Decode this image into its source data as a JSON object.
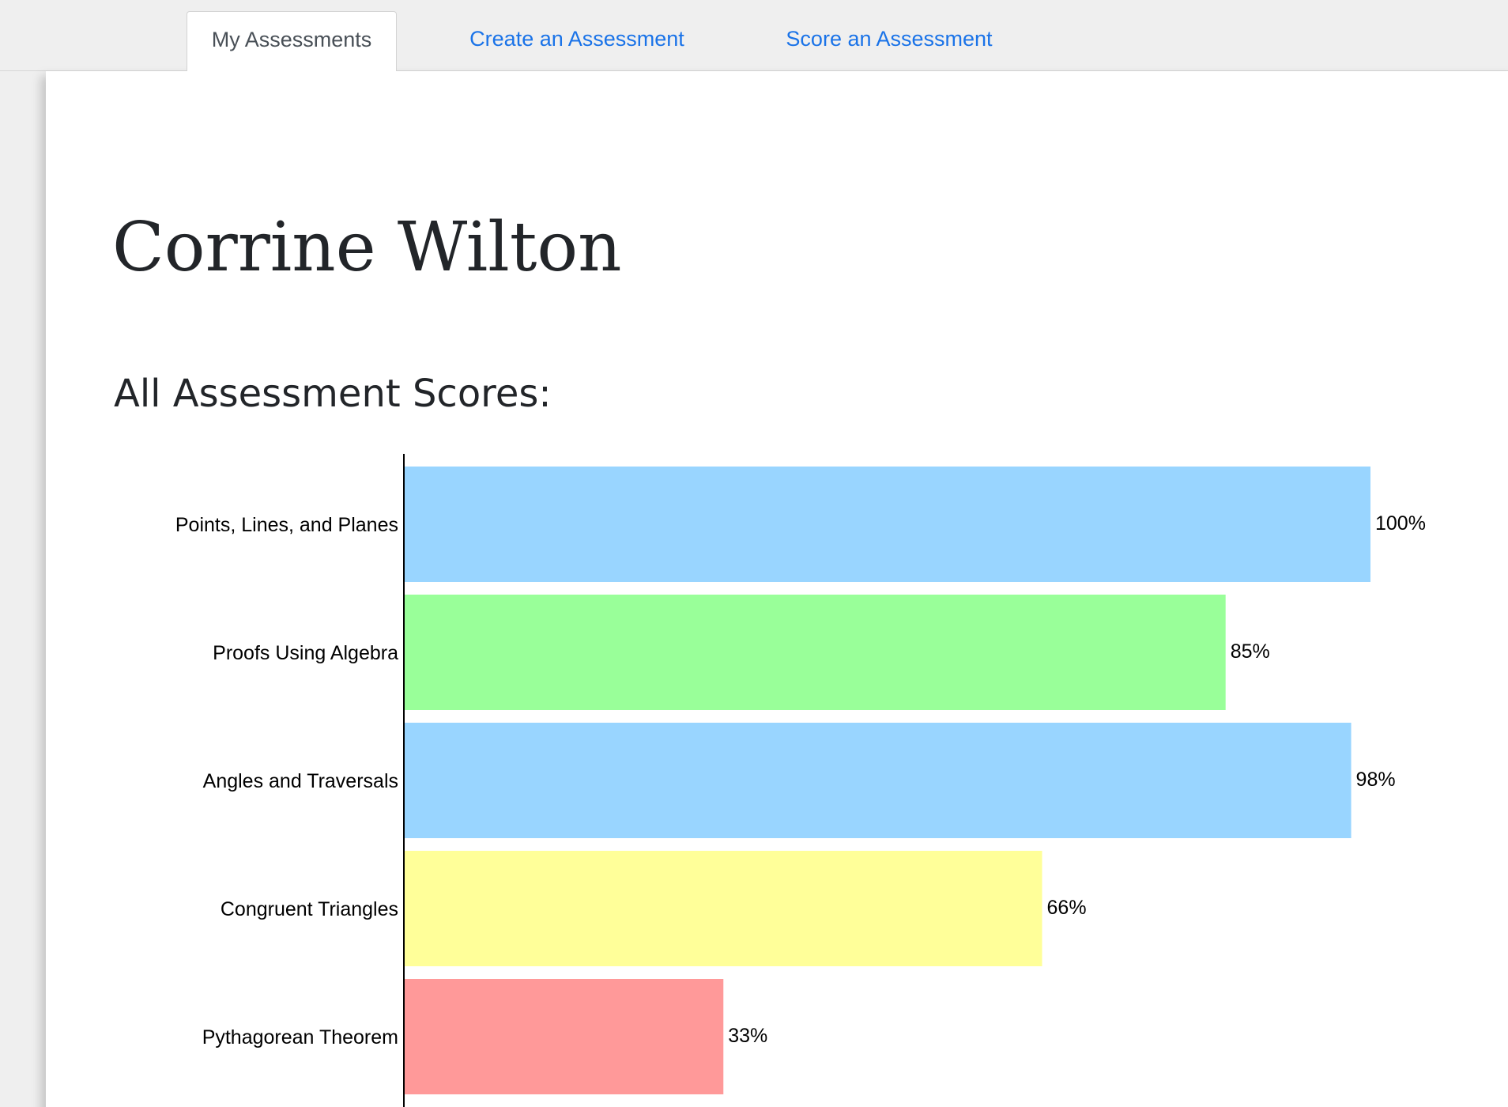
{
  "tabs": [
    {
      "label": "My Assessments",
      "active": true
    },
    {
      "label": "Create an Assessment",
      "active": false
    },
    {
      "label": "Score an Assessment",
      "active": false
    }
  ],
  "student": {
    "name": "Corrine Wilton"
  },
  "section_title": "All Assessment Scores:",
  "colors": {
    "link": "#1a73e8",
    "tab_active_text": "#495057",
    "heading": "#222529",
    "background": "#efefef",
    "card": "#ffffff"
  },
  "chart_data": {
    "type": "bar",
    "orientation": "horizontal",
    "categories": [
      "Points, Lines, and Planes",
      "Proofs Using Algebra",
      "Angles and Traversals",
      "Congruent Triangles",
      "Pythagorean Theorem"
    ],
    "values": [
      100,
      85,
      98,
      66,
      33
    ],
    "value_labels": [
      "100%",
      "85%",
      "98%",
      "66%",
      "33%"
    ],
    "colors": [
      "#99d5ff",
      "#99ff99",
      "#99d5ff",
      "#ffff99",
      "#ff9999"
    ],
    "title": "",
    "xlabel": "",
    "ylabel": "",
    "xlim": [
      0,
      100
    ],
    "grid": false,
    "legend": "none"
  }
}
